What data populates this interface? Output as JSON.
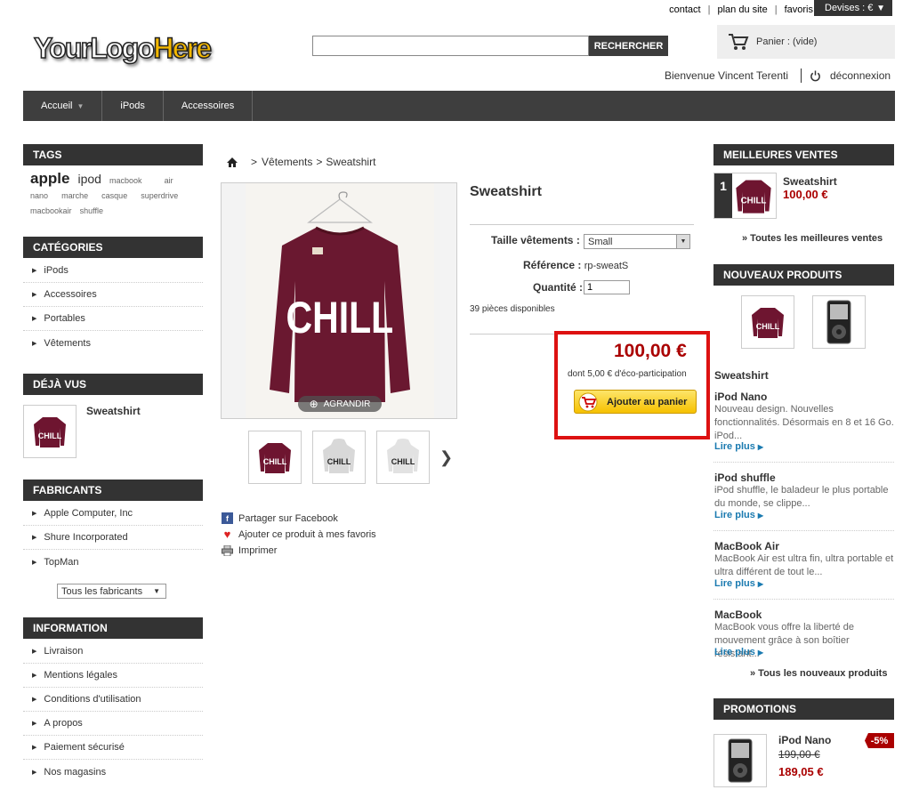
{
  "top_links": [
    "contact",
    "plan du site",
    "favoris"
  ],
  "currency_label": "Devises : €",
  "logo": {
    "part1": "YourLogo",
    "part2": "Here"
  },
  "search": {
    "placeholder": "",
    "button": "RECHERCHER"
  },
  "cart": {
    "label": "Panier : (vide)"
  },
  "welcome": {
    "text": "Bienvenue Vincent Terenti",
    "logout": "déconnexion"
  },
  "nav": [
    {
      "label": "Accueil"
    },
    {
      "label": "iPods"
    },
    {
      "label": "Accessoires"
    }
  ],
  "tags": {
    "title": "TAGS",
    "items": [
      "apple",
      "ipod",
      "macbook",
      "air",
      "nano",
      "marche",
      "casque",
      "superdrive",
      "macbookair",
      "shuffle"
    ]
  },
  "categories": {
    "title": "CATÉGORIES",
    "items": [
      "iPods",
      "Accessoires",
      "Portables",
      "Vêtements"
    ]
  },
  "viewed": {
    "title": "DÉJÀ VUS",
    "item": "Sweatshirt"
  },
  "manufacturers": {
    "title": "FABRICANTS",
    "items": [
      "Apple Computer, Inc",
      "Shure Incorporated",
      "TopMan"
    ],
    "select": "Tous les fabricants"
  },
  "information": {
    "title": "INFORMATION",
    "items": [
      "Livraison",
      "Mentions légales",
      "Conditions d'utilisation",
      "A propos",
      "Paiement sécurisé",
      "Nos magasins"
    ]
  },
  "breadcrumb": {
    "sep": ">",
    "items": [
      "Vêtements",
      "Sweatshirt"
    ]
  },
  "product": {
    "title": "Sweatshirt",
    "image_text": "CHILL",
    "zoom": "AGRANDIR",
    "size_label": "Taille vêtements :",
    "size_value": "Small",
    "ref_label": "Référence :",
    "ref_value": "rp-sweatS",
    "qty_label": "Quantité :",
    "qty_value": "1",
    "stock": "39 pièces disponibles",
    "price": "100,00 €",
    "eco": "dont 5,00 € d'éco-participation",
    "add_to_cart": "Ajouter au panier"
  },
  "share": {
    "facebook": "Partager sur Facebook",
    "favorite": "Ajouter ce produit à mes favoris",
    "print": "Imprimer"
  },
  "best_sellers": {
    "title": "MEILLEURES VENTES",
    "rank": "1",
    "name": "Sweatshirt",
    "price": "100,00 €",
    "all": "» Toutes les meilleures ventes"
  },
  "new_products": {
    "title": "NOUVEAUX PRODUITS",
    "items": [
      {
        "name": "Sweatshirt",
        "desc": ""
      },
      {
        "name": "iPod Nano",
        "desc": "Nouveau design. Nouvelles fonctionnalités. Désormais en 8 et 16 Go. iPod..."
      },
      {
        "name": "iPod shuffle",
        "desc": "iPod shuffle, le baladeur le plus portable du monde, se clippe..."
      },
      {
        "name": "MacBook Air",
        "desc": "MacBook Air est ultra fin, ultra portable et ultra différent de tout le..."
      },
      {
        "name": "MacBook",
        "desc": "MacBook vous offre la liberté de mouvement grâce à son boîtier résistant..."
      }
    ],
    "read_more": "Lire plus",
    "all": "» Tous les nouveaux produits"
  },
  "promotions": {
    "title": "PROMOTIONS",
    "name": "iPod Nano",
    "old_price": "199,00 €",
    "new_price": "189,05 €",
    "discount": "-5%"
  },
  "colors": {
    "accent_red": "#aa0000",
    "dark_bar": "#333333",
    "link_blue": "#1a7ab0",
    "highlight_box": "#dd1111"
  }
}
